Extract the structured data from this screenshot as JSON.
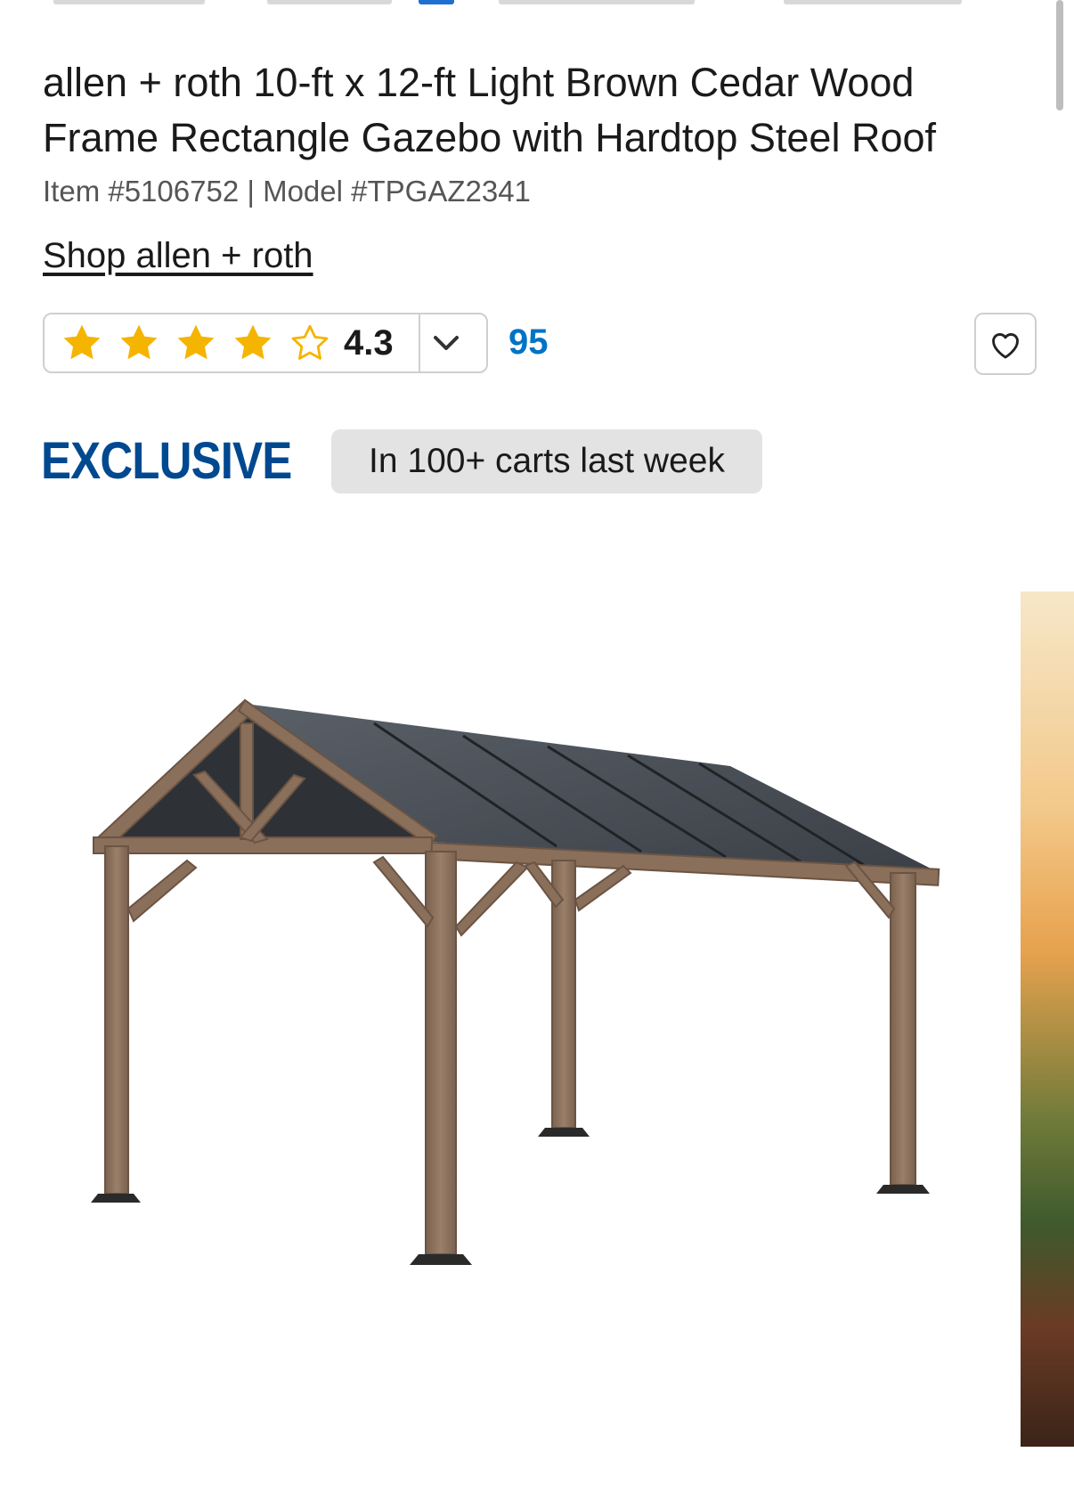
{
  "product": {
    "title": "allen + roth 10-ft x 12-ft Light Brown Cedar Wood Frame Rectangle Gazebo with Hardtop Steel Roof",
    "item_number": "Item #5106752",
    "separator": "|",
    "model_number": "Model #TPGAZ2341",
    "shop_brand_link": "Shop allen + roth"
  },
  "rating": {
    "value": "4.3",
    "stars_filled": 4,
    "stars_total": 5,
    "review_count": "95",
    "star_color": "#f5b400"
  },
  "badges": {
    "exclusive": "EXCLUSIVE",
    "cart_activity": "In 100+ carts last week",
    "exclusive_color": "#004990"
  },
  "icons": {
    "favorite": "heart-outline-icon",
    "dropdown": "chevron-down-icon"
  },
  "gallery": {
    "main_image": "gazebo-product-photo",
    "next_image": "gazebo-lifestyle-photo"
  }
}
